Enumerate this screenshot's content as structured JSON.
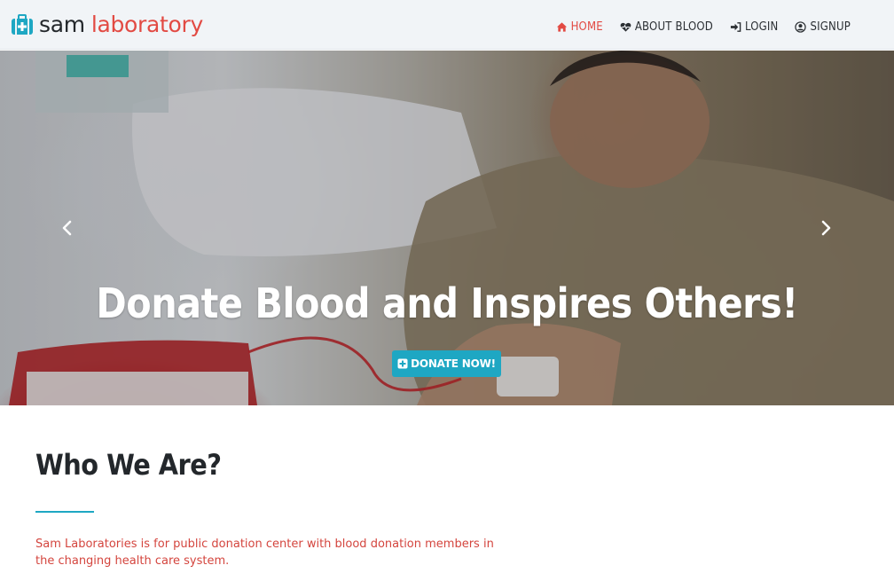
{
  "brand": {
    "name_part1": "sam",
    "name_part2": "laboratory",
    "icon": "medical-kit-icon"
  },
  "nav": {
    "items": [
      {
        "label": "HOME",
        "icon": "home-icon",
        "active": true
      },
      {
        "label": "ABOUT BLOOD",
        "icon": "heart-pulse-icon",
        "active": false
      },
      {
        "label": "LOGIN",
        "icon": "sign-in-icon",
        "active": false
      },
      {
        "label": "SIGNUP",
        "icon": "user-circle-icon",
        "active": false
      }
    ]
  },
  "hero": {
    "title": "Donate Blood and Inspires Others!",
    "button_label": "DONATE NOW!",
    "button_icon": "plus-square-icon",
    "prev_icon": "chevron-left-icon",
    "next_icon": "chevron-right-icon"
  },
  "about": {
    "title": "Who We Are?",
    "text": "Sam Laboratories is for public donation center with blood donation members in the changing health care system."
  },
  "colors": {
    "accent": "#1ea7c3",
    "brand_red": "#e24a43",
    "nav_bg": "#f1f4f7"
  }
}
